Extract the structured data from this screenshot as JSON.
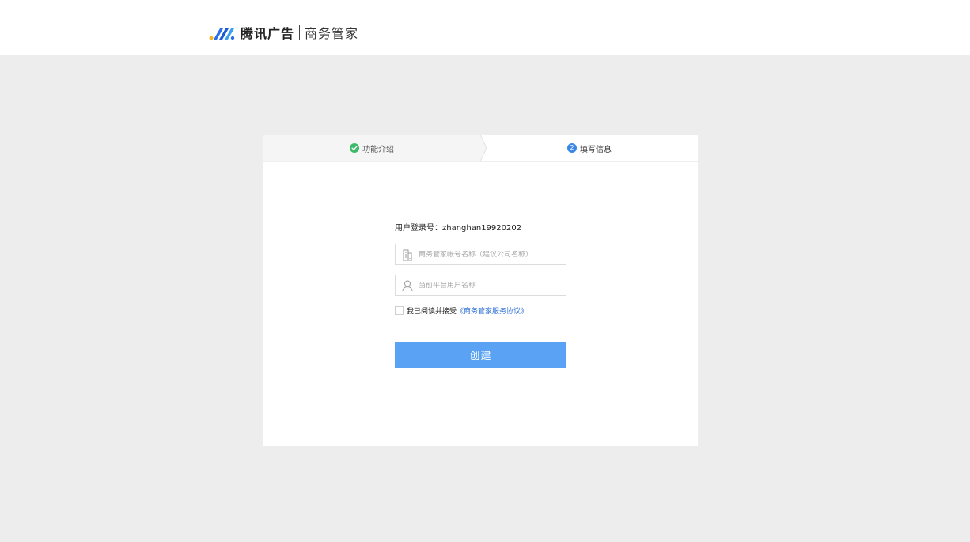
{
  "header": {
    "brand_name": "腾讯广告",
    "product_name": "商务管家",
    "logo_icon": "tencent-ads-logo-icon"
  },
  "steps": [
    {
      "label": "功能介绍",
      "status": "done",
      "icon": "check-circle-icon"
    },
    {
      "label": "填写信息",
      "status": "current",
      "number": "2"
    }
  ],
  "form": {
    "account_label": "用户登录号：",
    "account_value": "zhanghan19920202",
    "account_name_placeholder": "商务管家帐号名称（建议公司名称）",
    "account_name_icon": "building-icon",
    "username_placeholder": "当前平台用户名称",
    "username_icon": "user-icon",
    "agree_text": "我已阅读并接受",
    "agree_link": "《商务管家服务协议》",
    "agree_checked": false,
    "submit_label": "创建"
  },
  "colors": {
    "accent": "#5aa3f4",
    "link": "#2d6fd6",
    "success": "#3dbb6a",
    "step_number": "#3a86e6",
    "background": "#ededed"
  }
}
